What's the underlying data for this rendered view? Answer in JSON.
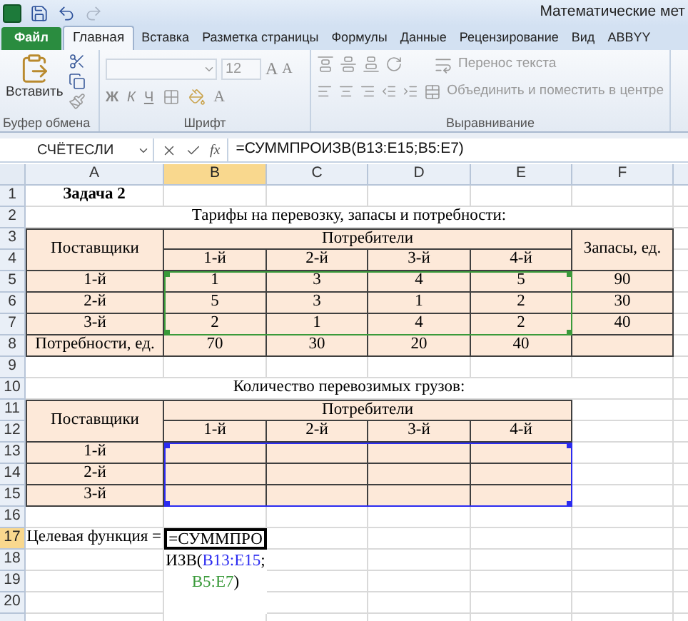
{
  "title_bar": {
    "title": "Математические мет"
  },
  "ribbon": {
    "tabs": [
      {
        "label": "Файл",
        "kind": "file",
        "selected": false
      },
      {
        "label": "Главная",
        "kind": "tab",
        "selected": true
      },
      {
        "label": "Вставка",
        "kind": "tab",
        "selected": false
      },
      {
        "label": "Разметка страницы",
        "kind": "tab",
        "selected": false
      },
      {
        "label": "Формулы",
        "kind": "tab",
        "selected": false
      },
      {
        "label": "Данные",
        "kind": "tab",
        "selected": false
      },
      {
        "label": "Рецензирование",
        "kind": "tab",
        "selected": false
      },
      {
        "label": "Вид",
        "kind": "tab",
        "selected": false
      },
      {
        "label": "ABBYY",
        "kind": "tab",
        "selected": false
      }
    ],
    "clipboard": {
      "paste": "Вставить",
      "label": "Буфер обмена"
    },
    "font": {
      "size": "12",
      "grow": "A",
      "shrink": "A",
      "bold": "Ж",
      "italic": "К",
      "underline": "Ч",
      "text_color": "A",
      "label": "Шрифт"
    },
    "alignment": {
      "wrap": "Перенос текста",
      "merge": "Объединить и поместить в центре",
      "label": "Выравнивание"
    }
  },
  "formula_bar": {
    "name_box": "СЧЁТЕСЛИ",
    "fx": "fx",
    "formula": "=СУММПРОИЗВ(B13:E15;B5:E7)"
  },
  "columns": [
    {
      "label": "A",
      "selected": false
    },
    {
      "label": "B",
      "selected": true
    },
    {
      "label": "C",
      "selected": false
    },
    {
      "label": "D",
      "selected": false
    },
    {
      "label": "E",
      "selected": false
    },
    {
      "label": "F",
      "selected": false
    }
  ],
  "rows": [
    {
      "label": "1",
      "selected": false
    },
    {
      "label": "2",
      "selected": false
    },
    {
      "label": "3",
      "selected": false
    },
    {
      "label": "4",
      "selected": false
    },
    {
      "label": "5",
      "selected": false
    },
    {
      "label": "6",
      "selected": false
    },
    {
      "label": "7",
      "selected": false
    },
    {
      "label": "8",
      "selected": false
    },
    {
      "label": "9",
      "selected": false
    },
    {
      "label": "10",
      "selected": false
    },
    {
      "label": "11",
      "selected": false
    },
    {
      "label": "12",
      "selected": false
    },
    {
      "label": "13",
      "selected": false
    },
    {
      "label": "14",
      "selected": false
    },
    {
      "label": "15",
      "selected": false
    },
    {
      "label": "16",
      "selected": false
    },
    {
      "label": "17",
      "selected": true
    },
    {
      "label": "18",
      "selected": false
    },
    {
      "label": "19",
      "selected": false
    },
    {
      "label": "20",
      "selected": false
    }
  ],
  "sheet_title": "Задача 2",
  "tables": [
    {
      "caption": "Тарифы на перевозку, запасы и потребности:",
      "supplier_header": "Поставщики",
      "consumer_header": "Потребители",
      "consumers": [
        "1-й",
        "2-й",
        "3-й",
        "4-й"
      ],
      "stock_header": "Запасы, ед.",
      "color": "#3a9a3a",
      "rows": [
        {
          "label": "1-й",
          "values": [
            "1",
            "3",
            "4",
            "5"
          ],
          "stock": "90"
        },
        {
          "label": "2-й",
          "values": [
            "5",
            "3",
            "1",
            "2"
          ],
          "stock": "30"
        },
        {
          "label": "3-й",
          "values": [
            "2",
            "1",
            "4",
            "2"
          ],
          "stock": "40"
        }
      ],
      "totals": {
        "label": "Потребности, ед.",
        "values": [
          "70",
          "30",
          "20",
          "40"
        ]
      }
    },
    {
      "caption": "Количество перевозимых грузов:",
      "supplier_header": "Поставщики",
      "consumer_header": "Потребители",
      "consumers": [
        "1-й",
        "2-й",
        "3-й",
        "4-й"
      ],
      "color": "#2b2bf0",
      "rows": [
        {
          "label": "1-й"
        },
        {
          "label": "2-й"
        },
        {
          "label": "3-й"
        }
      ]
    }
  ],
  "objective": {
    "label": "Целевая функция =",
    "parts": [
      {
        "text": "=СУММПРОИЗВ(",
        "kind": "plain"
      },
      {
        "text": "B13:E15",
        "kind": "ref",
        "color": "#2b2bf0"
      },
      {
        "text": ";",
        "kind": "plain"
      },
      {
        "text": "B5:E7",
        "kind": "ref",
        "color": "#3a9a3a"
      },
      {
        "text": ")",
        "kind": "plain"
      }
    ]
  }
}
